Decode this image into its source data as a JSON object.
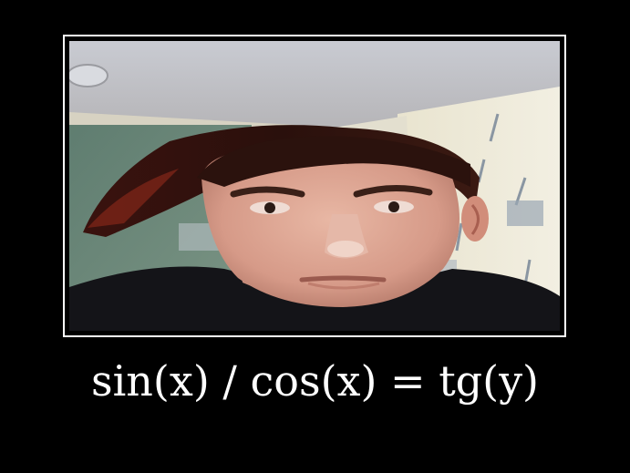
{
  "caption": "sin(x) / cos(x) = tg(y)",
  "colors": {
    "background": "#000000",
    "frame_border": "#ffffff",
    "caption_text": "#ffffff"
  }
}
